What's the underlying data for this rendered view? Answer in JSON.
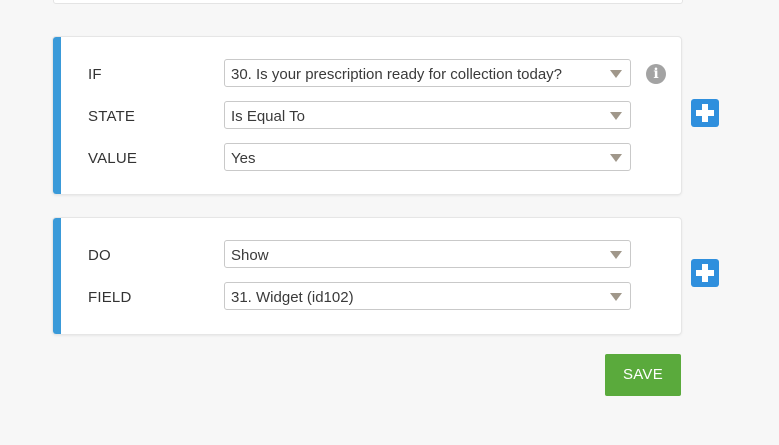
{
  "condition": {
    "if": {
      "label": "IF",
      "value": "30. Is your prescription ready for collection today?"
    },
    "state": {
      "label": "STATE",
      "value": "Is Equal To"
    },
    "value": {
      "label": "VALUE",
      "value": "Yes"
    },
    "info_icon": "info-circle-icon",
    "info_glyph": "i",
    "add_icon": "plus-icon"
  },
  "action": {
    "do": {
      "label": "DO",
      "value": "Show"
    },
    "field": {
      "label": "FIELD",
      "value": "31. Widget (id102)"
    },
    "add_icon": "plus-icon"
  },
  "save_label": "SAVE",
  "colors": {
    "accent": "#3a9ad9",
    "add_button": "#2f8fdd",
    "save_button": "#5aaa3c",
    "info_icon": "#a3a3a3"
  }
}
